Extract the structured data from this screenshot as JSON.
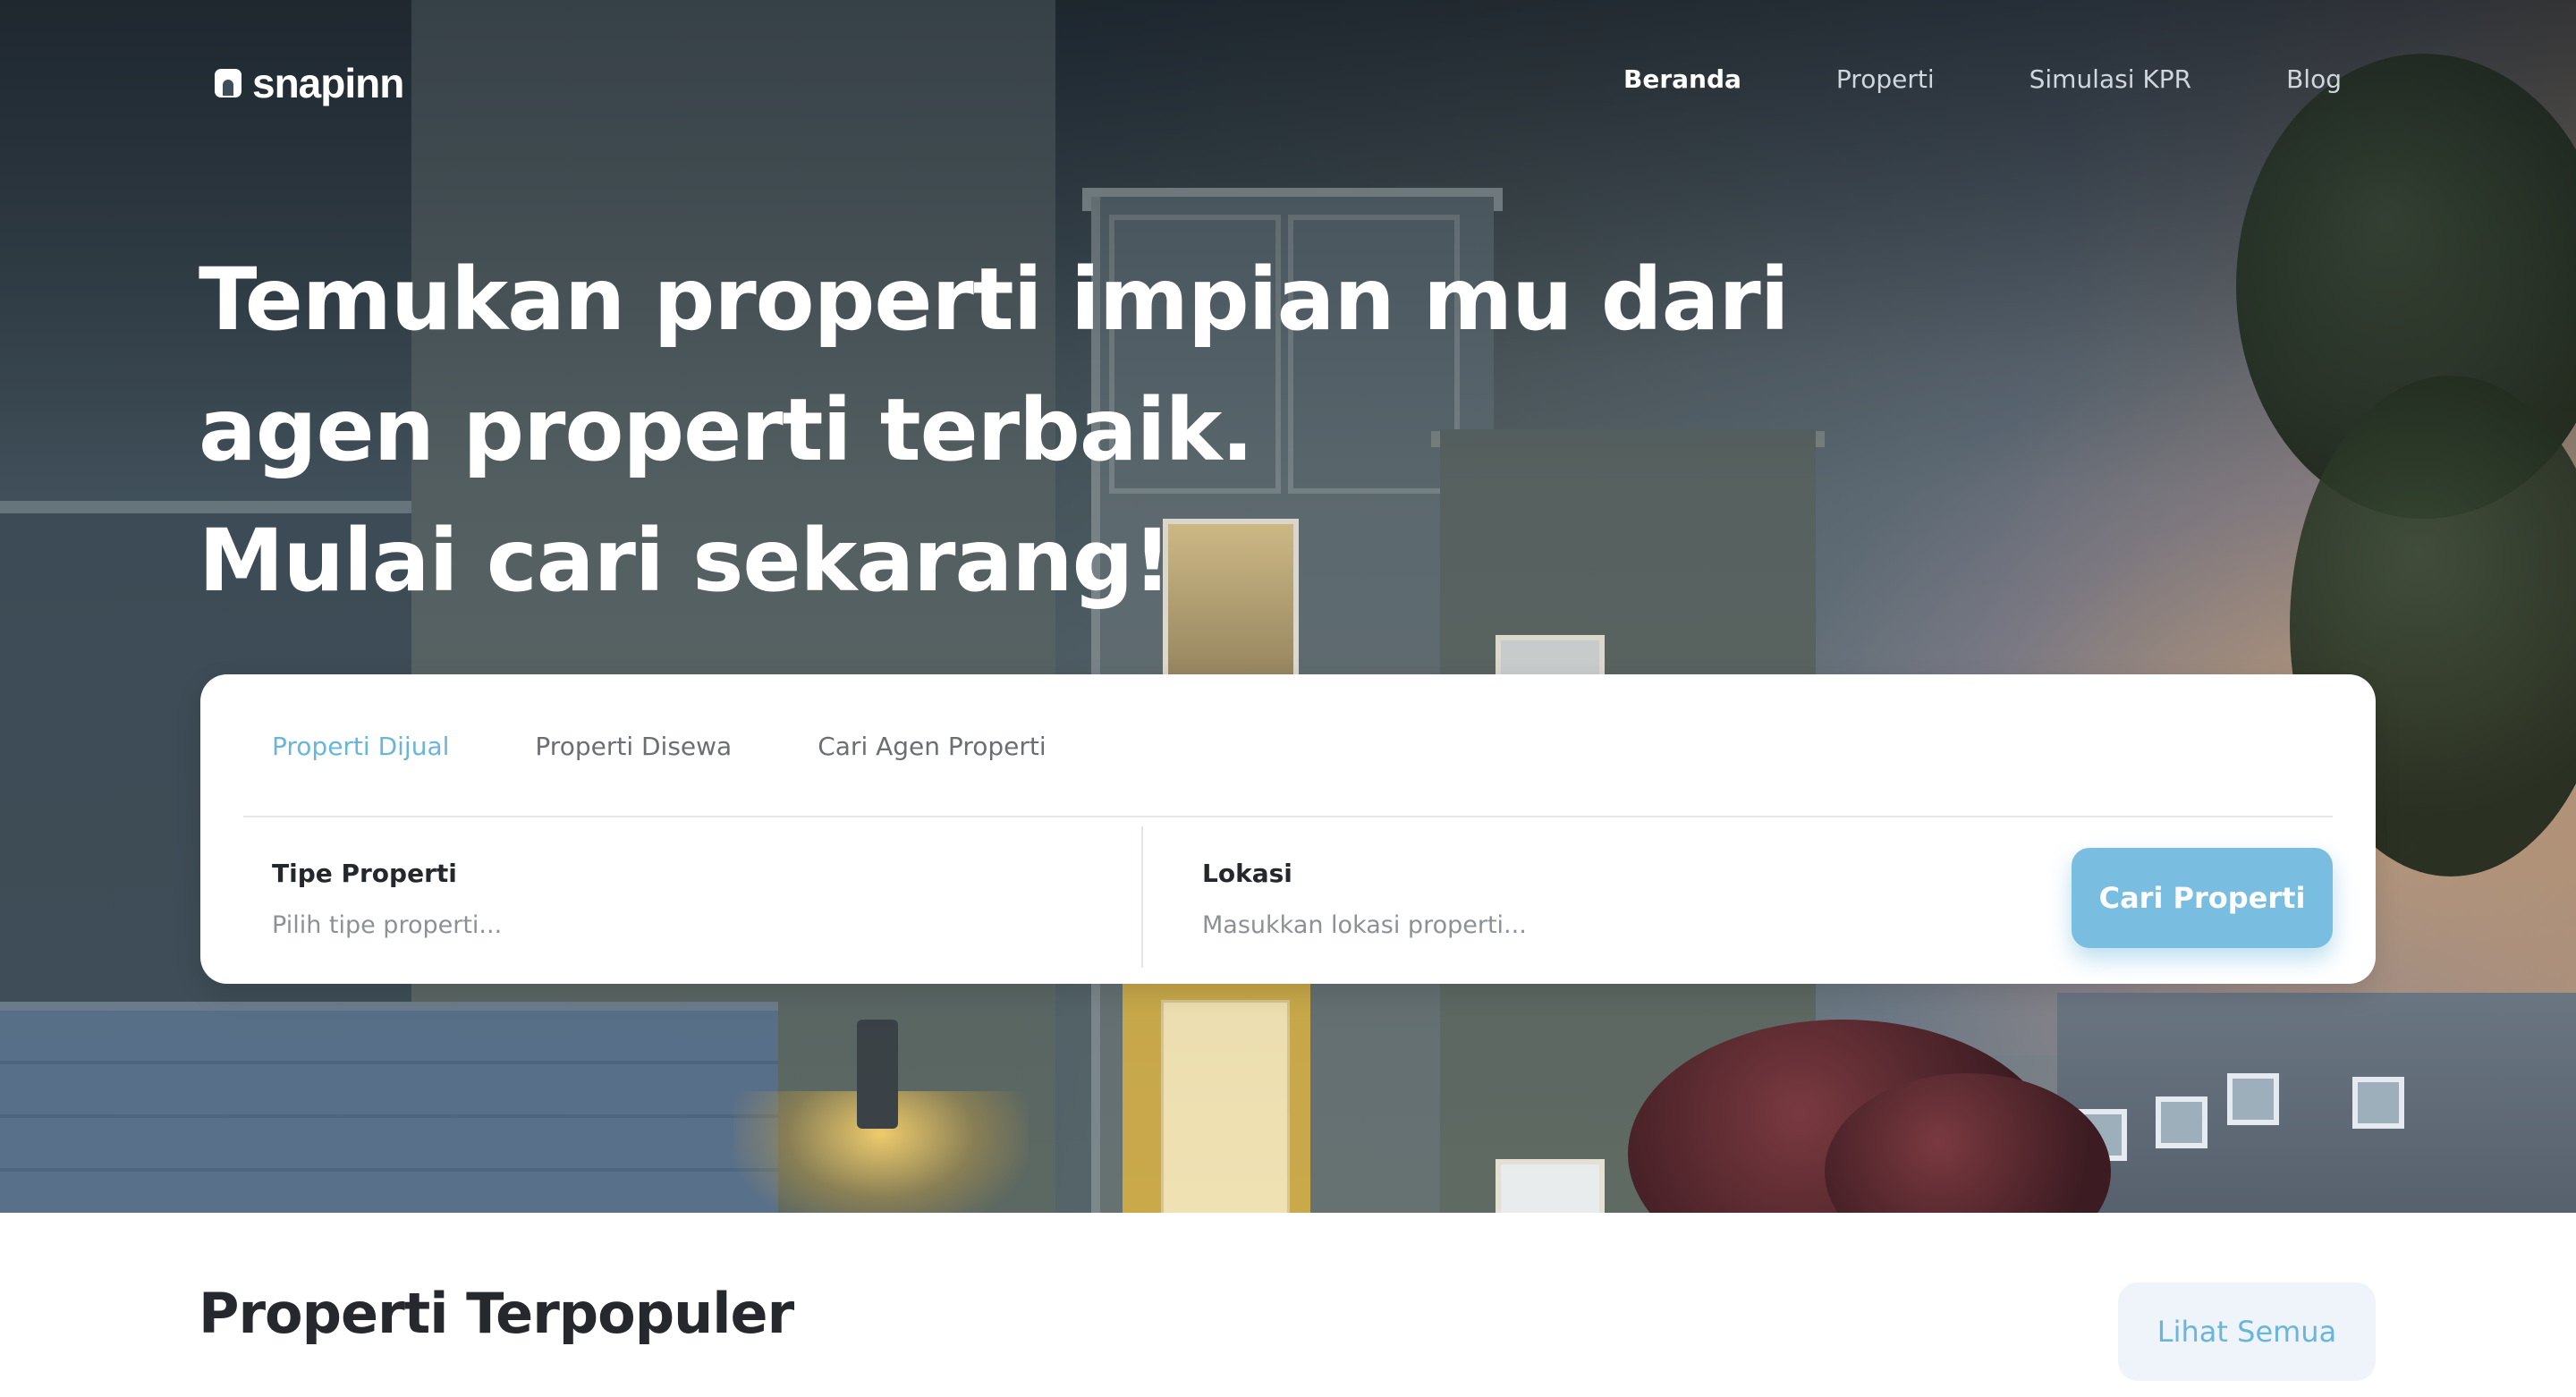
{
  "nav": {
    "logo_text": "snapinn",
    "links": [
      {
        "label": "Beranda",
        "active": true
      },
      {
        "label": "Properti",
        "active": false
      },
      {
        "label": "Simulasi KPR",
        "active": false
      },
      {
        "label": "Blog",
        "active": false
      }
    ]
  },
  "hero": {
    "headline_lines": [
      "Temukan properti impian mu dari",
      "agen properti terbaik.",
      "Mulai cari sekarang!"
    ]
  },
  "search": {
    "tabs": [
      {
        "label": "Properti Dijual",
        "active": true
      },
      {
        "label": "Properti Disewa",
        "active": false
      },
      {
        "label": "Cari Agen Properti",
        "active": false
      }
    ],
    "type_field": {
      "label": "Tipe Properti",
      "placeholder": "Pilih tipe properti..."
    },
    "location_field": {
      "label": "Lokasi",
      "placeholder": "Masukkan lokasi properti..."
    },
    "button_label": "Cari Properti"
  },
  "popular": {
    "title": "Properti Terpopuler",
    "see_all_label": "Lihat Semua"
  },
  "colors": {
    "accent": "#69b6da",
    "button": "#79bde0",
    "heading_text": "#25292d"
  }
}
